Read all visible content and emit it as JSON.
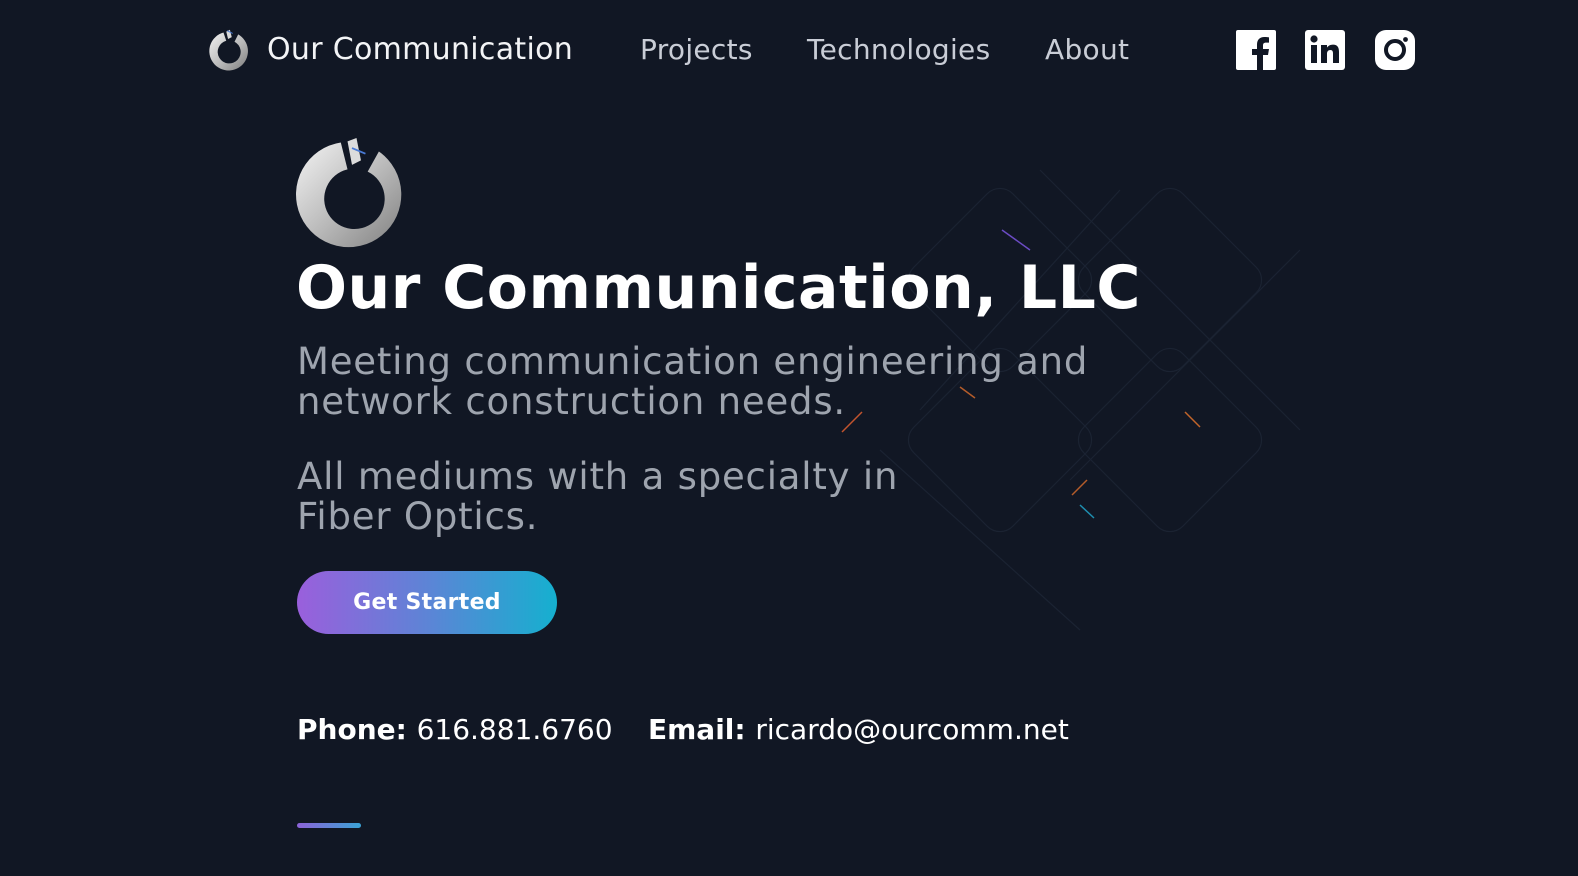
{
  "nav": {
    "brand": "Our Communication",
    "links": [
      {
        "label": "Projects"
      },
      {
        "label": "Technologies"
      },
      {
        "label": "About"
      }
    ],
    "social": [
      {
        "icon": "facebook-icon"
      },
      {
        "icon": "linkedin-icon"
      },
      {
        "icon": "instagram-icon"
      }
    ]
  },
  "hero": {
    "title": "Our Communication, LLC",
    "subtitle": "Meeting communication engineering and network construction needs.",
    "tagline": "All mediums with a specialty in Fiber Optics.",
    "cta_label": "Get Started"
  },
  "contact": {
    "phone_label": "Phone:",
    "phone": "616.881.6760",
    "email_label": "Email:",
    "email": "ricardo@ourcomm.net"
  },
  "colors": {
    "background": "#111724",
    "cta_gradient_start": "#9a5fdc",
    "cta_gradient_end": "#15b0cf",
    "muted_text": "#9ea4ae"
  }
}
